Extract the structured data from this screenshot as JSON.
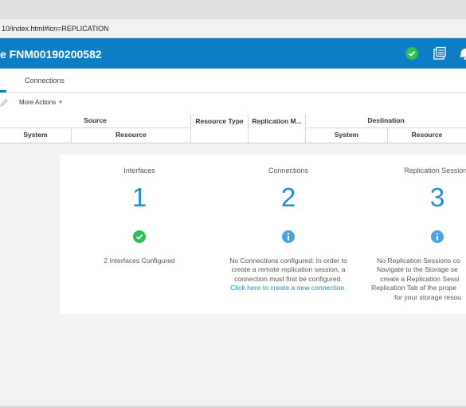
{
  "browser": {
    "url_suffix": "10/index.html#lcn=REPLICATION"
  },
  "header": {
    "title": "e FNM00190200582"
  },
  "tabs": {
    "connections": "Connections"
  },
  "toolbar": {
    "more_actions": "More Actions"
  },
  "table": {
    "group_source": "Source",
    "group_destination": "Destination",
    "col_resource_type": "Resource Type",
    "col_replication_mode": "Replication M...",
    "col_system": "System",
    "col_resource": "Resource",
    "col_dest_system": "System",
    "col_dest_resource": "Resource"
  },
  "summary": {
    "interfaces": {
      "label": "Interfaces",
      "count": "1",
      "desc": "2 Interfaces Configured"
    },
    "connections": {
      "label": "Connections",
      "count": "2",
      "line1": "No Connections configured: In order to",
      "line2": "create a remote replication session, a",
      "line3": "connection must first be configured.",
      "link": "Click here to create a new connection."
    },
    "sessions": {
      "label": "Replication Sessions",
      "count": "3",
      "line1": "No Replication Sessions co",
      "line2": "Navigate to the Storage se",
      "line3": "create a Replication Sessi",
      "line4": "Replication Tab of the prope",
      "line5": "for your storage resou"
    }
  },
  "icons": {
    "status_ok": "check-circle-icon",
    "logs": "logs-icon",
    "alerts": "bell-icon",
    "info": "info-icon"
  },
  "colors": {
    "brand": "#0d7dc4",
    "ok": "#2fbf55",
    "info": "#4aa3df",
    "count": "#1f8ccf"
  }
}
